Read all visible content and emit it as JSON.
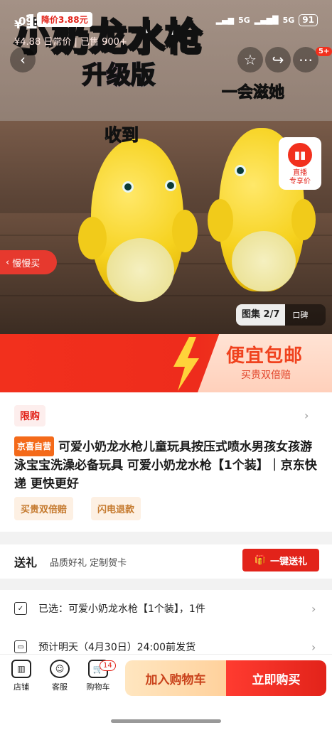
{
  "status_bar": {
    "time": "09:49",
    "signal1": "5G",
    "signal2": "5G",
    "battery": "91"
  },
  "hero": {
    "title_art": "小奶龙水枪",
    "upgrade_art": "升级版",
    "caption_left": "收到",
    "caption_right": "一会滋她",
    "live_label_1": "直播",
    "live_label_2": "专享价",
    "slow_buy": "慢慢买",
    "gallery_count": "图集 2/7",
    "gallery_extra": "口碑",
    "share_badge": "5+"
  },
  "price": {
    "currency": "¥",
    "value": "1",
    "drop_tag": "降价3.88元",
    "sub_line": "¥4.88  日常价  |  已售 900+",
    "promo_title": "便宜包邮",
    "promo_sub": "买贵双倍赔"
  },
  "info": {
    "flash_tag": "限购",
    "jd_tag": "京喜自营",
    "title": "可爱小奶龙水枪儿童玩具按压式喷水男孩女孩游泳宝宝洗澡必备玩具 可爱小奶龙水枪【1个装】｜京东快递 更快更好",
    "service_tags": [
      "买贵双倍赔",
      "闪电退款"
    ]
  },
  "gift": {
    "title": "送礼",
    "desc": "品质好礼 定制贺卡",
    "button": "一键送礼"
  },
  "selection": {
    "selected": "已选：可爱小奶龙水枪【1个装】，1件",
    "delivery": "预计明天（4月30日）24:00前发货"
  },
  "bottom_nav": {
    "store": "店铺",
    "service": "客服",
    "cart": "购物车",
    "cart_count": "14",
    "add_cart": "加入购物车",
    "buy_now": "立即购买"
  },
  "colors": {
    "brand_red": "#e2231a",
    "accent_orange": "#f46a1a"
  }
}
